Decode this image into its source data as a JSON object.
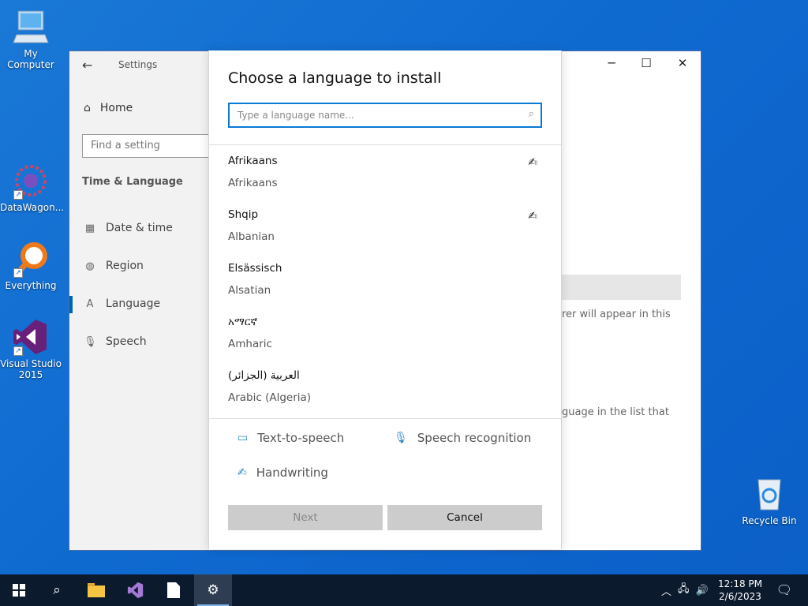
{
  "desktop": {
    "icons": [
      {
        "label": "My Computer"
      },
      {
        "label": "DataWagon..."
      },
      {
        "label": "Everything"
      },
      {
        "label": "Visual Studio 2015"
      },
      {
        "label": "Recycle Bin"
      }
    ]
  },
  "settings": {
    "title": "Settings",
    "home": "Home",
    "search_placeholder": "Find a setting",
    "section": "Time & Language",
    "nav_items": [
      {
        "label": "Date & time",
        "icon": "calendar-icon"
      },
      {
        "label": "Region",
        "icon": "globe-icon"
      },
      {
        "label": "Language",
        "icon": "language-icon"
      },
      {
        "label": "Speech",
        "icon": "microphone-icon"
      }
    ],
    "bg_text_1": "rer will appear in this",
    "bg_text_2": "guage in the list that"
  },
  "dialog": {
    "title": "Choose a language to install",
    "search_placeholder": "Type a language name...",
    "languages": [
      {
        "native": "Afrikaans",
        "english": "Afrikaans",
        "handwriting": true
      },
      {
        "native": "Shqip",
        "english": "Albanian",
        "handwriting": true
      },
      {
        "native": "Elsässisch",
        "english": "Alsatian",
        "handwriting": false
      },
      {
        "native": "አማርኛ",
        "english": "Amharic",
        "handwriting": false
      },
      {
        "native": "العربية (الجزائر)",
        "english": "Arabic (Algeria)",
        "handwriting": false
      }
    ],
    "features": {
      "tts": "Text-to-speech",
      "speech": "Speech recognition",
      "handwriting": "Handwriting"
    },
    "next_label": "Next",
    "cancel_label": "Cancel"
  },
  "taskbar": {
    "time": "12:18 PM",
    "date": "2/6/2023"
  },
  "colors": {
    "accent": "#0a7ad6",
    "desktop": "#1a78d6",
    "taskbar": "#0c1a2e"
  }
}
